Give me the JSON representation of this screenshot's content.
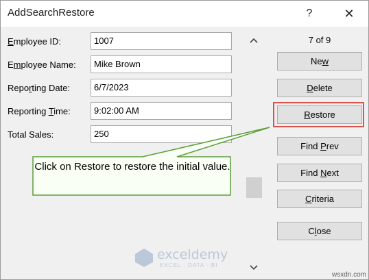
{
  "window": {
    "title": "AddSearchRestore",
    "help_symbol": "?",
    "close_symbol": "✕"
  },
  "fields": [
    {
      "label": "Employee ID:",
      "access_key_index": 0,
      "value": "1007"
    },
    {
      "label": "Employee Name:",
      "access_key_index": 0,
      "value": "Mike Brown"
    },
    {
      "label": "Reporting Date:",
      "access_key_index": 12,
      "value": "6/7/2023"
    },
    {
      "label": "Reporting Time:",
      "access_key_index": 10,
      "value": "9:02:00 AM"
    },
    {
      "label": "Total Sales:",
      "access_key_index": 0,
      "value": "250"
    }
  ],
  "record_counter": "7 of 9",
  "buttons": {
    "new": "New",
    "delete": "Delete",
    "restore": "Restore",
    "find_prev": "Find Prev",
    "find_next": "Find Next",
    "criteria": "Criteria",
    "close": "Close"
  },
  "callout": {
    "text": "Click on Restore to restore the initial value."
  },
  "watermark": {
    "name": "exceldemy",
    "sub": "EXCEL · DATA · BI"
  },
  "corner_mark": "wsxdn.com",
  "colors": {
    "highlight": "#d9534f",
    "callout_border": "#5b9e3a"
  }
}
